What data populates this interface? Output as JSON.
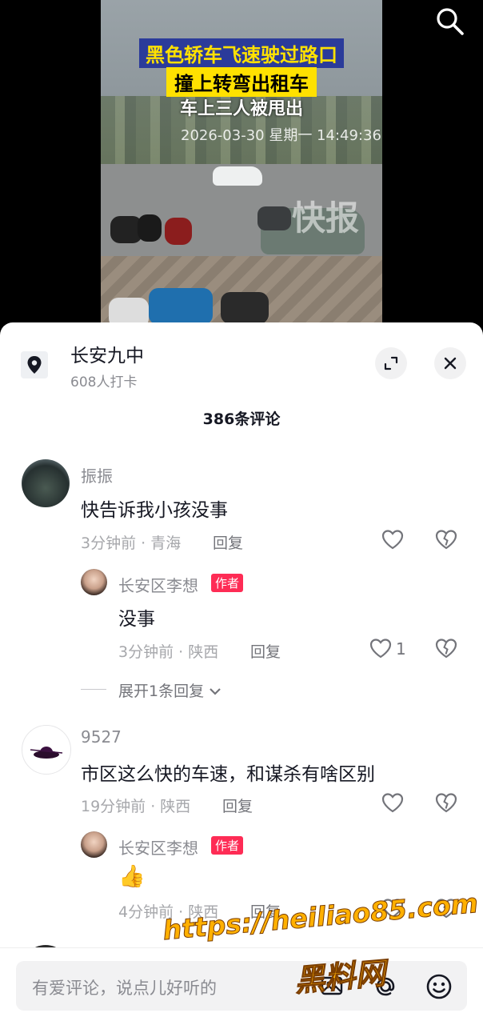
{
  "video": {
    "caption_line1": "黑色轿车飞速驶过路口",
    "caption_line2": "撞上转弯出租车",
    "caption_line3": "车上三人被甩出",
    "timestamp": "2026-03-30 星期一 14:49:36",
    "watermark": "快报"
  },
  "location": {
    "name": "长安九中",
    "checkins": "608人打卡"
  },
  "comments_count": "386条评论",
  "comments": [
    {
      "user": "振振",
      "text": "快告诉我小孩没事",
      "meta": "3分钟前 · 青海",
      "reply_label": "回复",
      "reply": {
        "user": "长安区李想",
        "badge": "作者",
        "text": "没事",
        "meta": "3分钟前 · 陕西",
        "reply_label": "回复",
        "likes": "1"
      },
      "expand": "展开1条回复"
    },
    {
      "user": "9527",
      "text": "市区这么快的车速，和谋杀有啥区别",
      "meta": "19分钟前 · 陕西",
      "reply_label": "回复",
      "reply": {
        "user": "长安区李想",
        "badge": "作者",
        "text": "👍",
        "meta": "4分钟前 · 陕西",
        "reply_label": "回复"
      }
    }
  ],
  "input": {
    "placeholder": "有爱评论，说点儿好听的"
  },
  "overlay_watermark": {
    "url": "https://heiliao85.com",
    "label": "黑料网"
  },
  "colors": {
    "accent": "#fe2c55",
    "text": "#161823",
    "secondary": "#8a8b91"
  }
}
